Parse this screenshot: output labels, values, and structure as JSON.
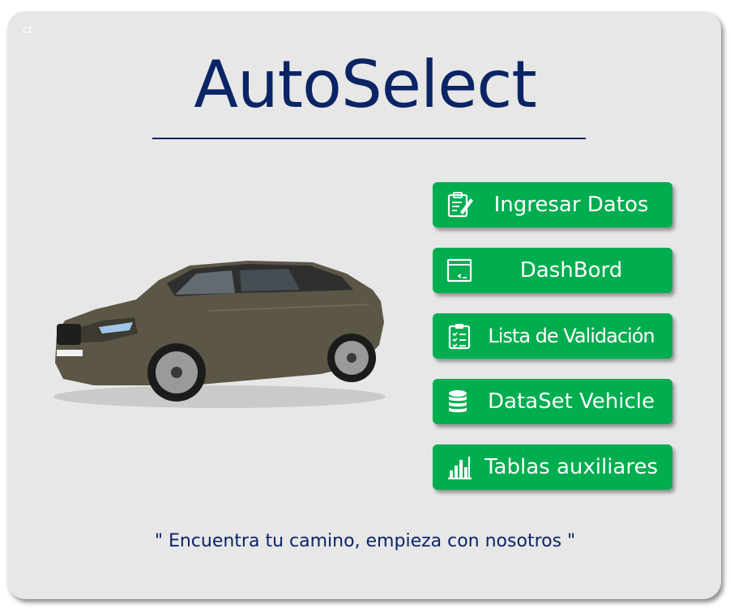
{
  "app": {
    "corner_tag": "ct",
    "title": "AutoSelect"
  },
  "menu": [
    {
      "label": "Ingresar Datos",
      "icon": "form-edit-icon"
    },
    {
      "label": "DashBord",
      "icon": "window-icon"
    },
    {
      "label": "Lista de Validación",
      "icon": "checklist-icon"
    },
    {
      "label": "DataSet Vehicle",
      "icon": "database-icon"
    },
    {
      "label": "Tablas auxiliares",
      "icon": "bar-chart-icon"
    }
  ],
  "tagline": "\" Encuentra tu camino, empieza con nosotros \"",
  "colors": {
    "brand_navy": "#0b2466",
    "button_green": "#00ad4f",
    "background": "#e7e7e7",
    "car_body": "#5b5646"
  }
}
